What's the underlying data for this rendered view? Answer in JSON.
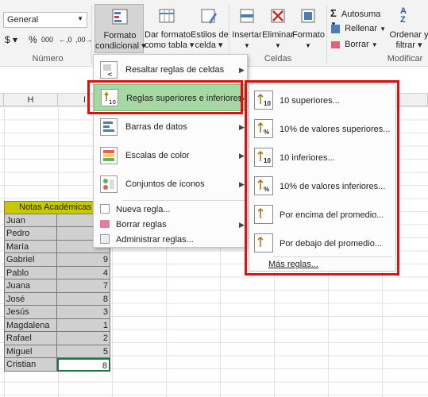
{
  "ribbon": {
    "number_format": "General",
    "number_group_label": "Número",
    "cells_group_label": "Celdas",
    "modify_group_label": "Modificar",
    "number_buttons": [
      "%",
      "000",
      "←,0",
      ",00→"
    ],
    "conditional_format_label_1": "Formato",
    "conditional_format_label_2": "condicional",
    "format_table_label_1": "Dar formato",
    "format_table_label_2": "como tabla",
    "cell_styles_label_1": "Estilos de",
    "cell_styles_label_2": "celda",
    "insert_label": "Insertar",
    "delete_label": "Eliminar",
    "format_label": "Formato",
    "autosum_label": "Autosuma",
    "fill_label": "Rellenar",
    "clear_label": "Borrar",
    "sort_label_1": "Ordenar y",
    "sort_label_2": "filtrar"
  },
  "columns": [
    "H",
    "I"
  ],
  "table": {
    "header": "Notas Académicas",
    "rows": [
      {
        "name": "Juan",
        "value": ""
      },
      {
        "name": "Pedro",
        "value": ""
      },
      {
        "name": "María",
        "value": ""
      },
      {
        "name": "Gabriel",
        "value": "9"
      },
      {
        "name": "Pablo",
        "value": "4"
      },
      {
        "name": "Juana",
        "value": "7"
      },
      {
        "name": "José",
        "value": "8"
      },
      {
        "name": "Jesús",
        "value": "3"
      },
      {
        "name": "Magdalena",
        "value": "1"
      },
      {
        "name": "Rafael",
        "value": "2"
      },
      {
        "name": "Miguel",
        "value": "5"
      },
      {
        "name": "Cristian",
        "value": "8"
      }
    ]
  },
  "menu": {
    "items": [
      {
        "label": "Resaltar reglas de celdas"
      },
      {
        "label": "Reglas superiores e inferiores"
      },
      {
        "label": "Barras de datos"
      },
      {
        "label": "Escalas de color"
      },
      {
        "label": "Conjuntos de iconos"
      }
    ],
    "actions": [
      {
        "label": "Nueva regla..."
      },
      {
        "label": "Borrar reglas"
      },
      {
        "label": "Administrar reglas..."
      }
    ]
  },
  "submenu": {
    "items": [
      {
        "label": "10 superiores...",
        "icon_text": "10"
      },
      {
        "label": "10% de valores superiores...",
        "icon_text": "%"
      },
      {
        "label": "10 inferiores...",
        "icon_text": "10"
      },
      {
        "label": "10% de valores inferiores...",
        "icon_text": "%"
      },
      {
        "label": "Por encima del promedio...",
        "icon_text": ""
      },
      {
        "label": "Por debajo del promedio...",
        "icon_text": ""
      }
    ],
    "more": "Más reglas..."
  },
  "colors": {
    "highlight": "#a6d8a6",
    "red_outline": "#e01010",
    "header_fill": "#c8c800"
  }
}
